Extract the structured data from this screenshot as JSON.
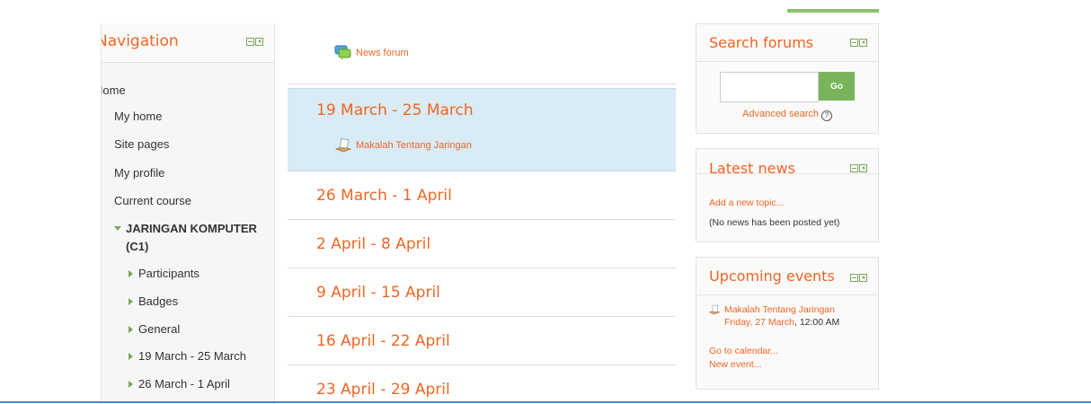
{
  "navigation": {
    "title": "Navigation",
    "items": [
      {
        "label": "Home"
      },
      {
        "label": "My home"
      },
      {
        "label": "Site pages"
      },
      {
        "label": "My profile"
      },
      {
        "label": "Current course"
      },
      {
        "label": "JARINGAN KOMPUTER"
      },
      {
        "label": "(C1)"
      },
      {
        "label": "Participants"
      },
      {
        "label": "Badges"
      },
      {
        "label": "General"
      },
      {
        "label": "19 March - 25 March"
      },
      {
        "label": "26 March - 1 April"
      }
    ]
  },
  "center": {
    "news_forum": "News forum",
    "sections": [
      {
        "title": "19 March - 25 March",
        "resource": "Makalah Tentang Jaringan"
      },
      {
        "title": "26 March - 1 April"
      },
      {
        "title": "2 April - 8 April"
      },
      {
        "title": "9 April - 15 April"
      },
      {
        "title": "16 April - 22 April"
      },
      {
        "title": "23 April - 29 April"
      }
    ]
  },
  "search_forums": {
    "title": "Search forums",
    "input_value": "",
    "go_label": "Go",
    "advanced": "Advanced search",
    "help_glyph": "?"
  },
  "latest_news": {
    "title": "Latest news",
    "add_topic": "Add a new topic...",
    "empty": "(No news has been posted yet)"
  },
  "upcoming_events": {
    "title": "Upcoming events",
    "event_name": "Makalah Tentang Jaringan",
    "event_date": "Friday, 27 March",
    "event_time": ", 12:00 AM",
    "go_calendar": "Go to calendar...",
    "new_event": "New event..."
  },
  "colors": {
    "accent": "#f26522",
    "green": "#79b45c",
    "highlight": "#d9ebf5"
  },
  "icons": [
    "forum-icon",
    "assignment-icon",
    "help-icon",
    "minimize-icon",
    "dock-icon"
  ]
}
